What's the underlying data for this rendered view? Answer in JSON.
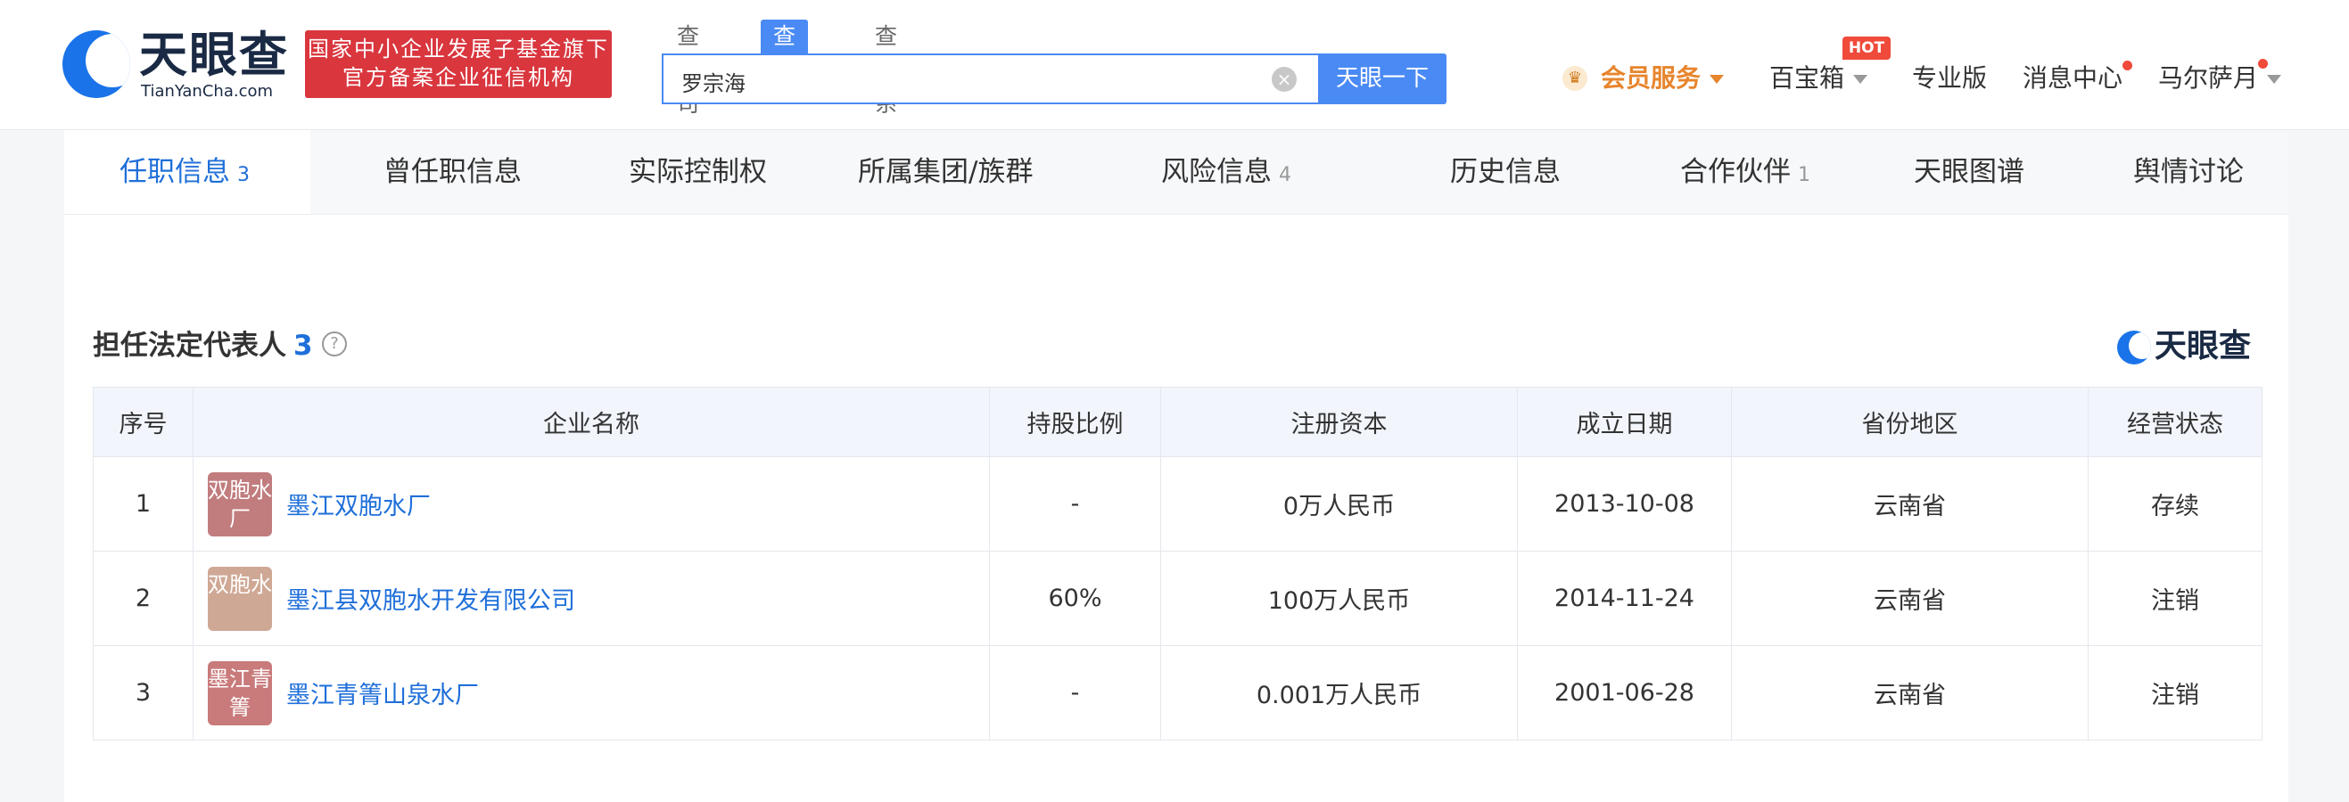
{
  "header": {
    "logo_cn": "天眼查",
    "logo_en": "TianYanCha.com",
    "badge_line1": "国家中小企业发展子基金旗下",
    "badge_line2": "官方备案企业征信机构",
    "search_tabs": [
      "查公司",
      "查老板",
      "查关系"
    ],
    "search_value": "罗宗海",
    "search_button": "天眼一下",
    "nav": {
      "member": "会员服务",
      "treasure": "百宝箱",
      "hot": "HOT",
      "pro": "专业版",
      "messages": "消息中心",
      "user": "马尔萨月"
    }
  },
  "tabs": [
    {
      "label": "任职信息",
      "count": "3"
    },
    {
      "label": "曾任职信息",
      "count": ""
    },
    {
      "label": "实际控制权",
      "count": ""
    },
    {
      "label": "所属集团/族群",
      "count": ""
    },
    {
      "label": "风险信息",
      "count": "4"
    },
    {
      "label": "历史信息",
      "count": ""
    },
    {
      "label": "合作伙伴",
      "count": "1"
    },
    {
      "label": "天眼图谱",
      "count": ""
    },
    {
      "label": "舆情讨论",
      "count": ""
    }
  ],
  "section": {
    "title": "担任法定代表人",
    "count": "3",
    "help": "?",
    "logo": "天眼查"
  },
  "table": {
    "columns": [
      "序号",
      "企业名称",
      "持股比例",
      "注册资本",
      "成立日期",
      "省份地区",
      "经营状态"
    ],
    "rows": [
      {
        "index": "1",
        "logo_text": "双胞水厂",
        "logo_color": "#c17c7e",
        "name": "墨江双胞水厂",
        "share": "-",
        "capital": "0万人民币",
        "date": "2013-10-08",
        "region": "云南省",
        "status": "存续",
        "status_color": "#3a9b4b"
      },
      {
        "index": "2",
        "logo_text": "双胞水",
        "logo_color": "#cfa895",
        "name": "墨江县双胞水开发有限公司",
        "share": "60%",
        "capital": "100万人民币",
        "date": "2014-11-24",
        "region": "云南省",
        "status": "注销",
        "status_color": "#e0463c"
      },
      {
        "index": "3",
        "logo_text": "墨江青箐",
        "logo_color": "#c97a7b",
        "name": "墨江青箐山泉水厂",
        "share": "-",
        "capital": "0.001万人民币",
        "date": "2001-06-28",
        "region": "云南省",
        "status": "注销",
        "status_color": "#e0463c"
      }
    ]
  }
}
